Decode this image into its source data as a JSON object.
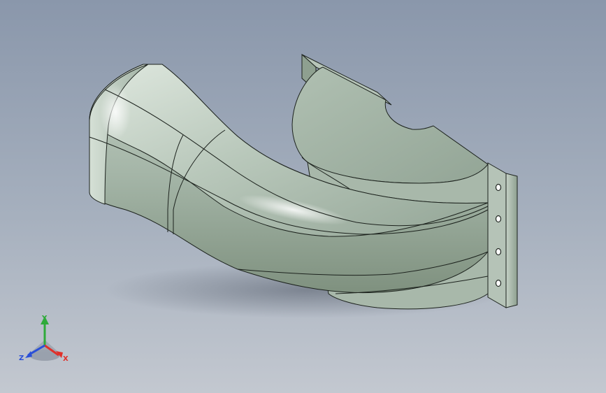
{
  "viewport": {
    "background_top": "#8a97ab",
    "background_bottom": "#c3c8d0",
    "model_face_color": "#9fb0a2",
    "model_edge_color": "#1c221d"
  },
  "model": {
    "name": "curved-duct-part",
    "mounting_flange": {
      "hole_count": 4
    }
  },
  "triad": {
    "x_label": "X",
    "y_label": "Y",
    "z_label": "Z",
    "x_color": "#e0302a",
    "y_color": "#2faa3a",
    "z_color": "#2a4fd8"
  }
}
